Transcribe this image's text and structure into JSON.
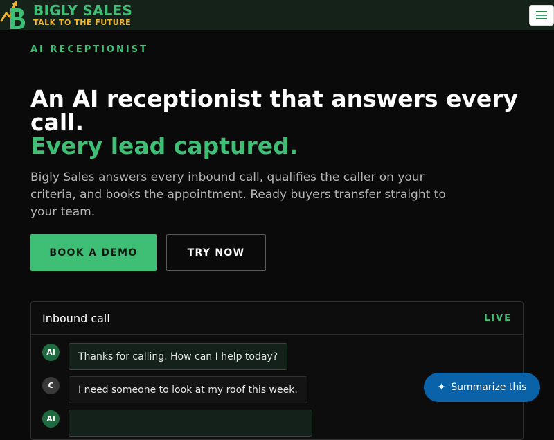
{
  "header": {
    "brand_name": "BIGLY SALES",
    "brand_tagline": "TALK TO THE FUTURE",
    "menu_icon": "hamburger-icon"
  },
  "hero": {
    "eyebrow": "AI RECEPTIONIST",
    "headline": "An AI receptionist that answers every call.",
    "headline_accent": "Every lead captured.",
    "subtext": "Bigly Sales answers every inbound call, qualifies the caller on your criteria, and books the appointment. Ready buyers transfer straight to your team.",
    "primary_button": "BOOK A DEMO",
    "secondary_button": "TRY NOW"
  },
  "call_card": {
    "title": "Inbound call",
    "status": "LIVE",
    "messages": [
      {
        "speaker": "AI",
        "text": "Thanks for calling. How can I help today?"
      },
      {
        "speaker": "C",
        "text": "I need someone to look at my roof this week."
      },
      {
        "speaker": "AI",
        "text": ""
      }
    ]
  },
  "summarize": {
    "icon": "sparkle-icon",
    "label": "Summarize this"
  },
  "colors": {
    "accent_green": "#3fbf76",
    "tagline_yellow": "#f2b52a",
    "summarize_blue": "#0a63a8",
    "background": "#0a0a0a"
  }
}
